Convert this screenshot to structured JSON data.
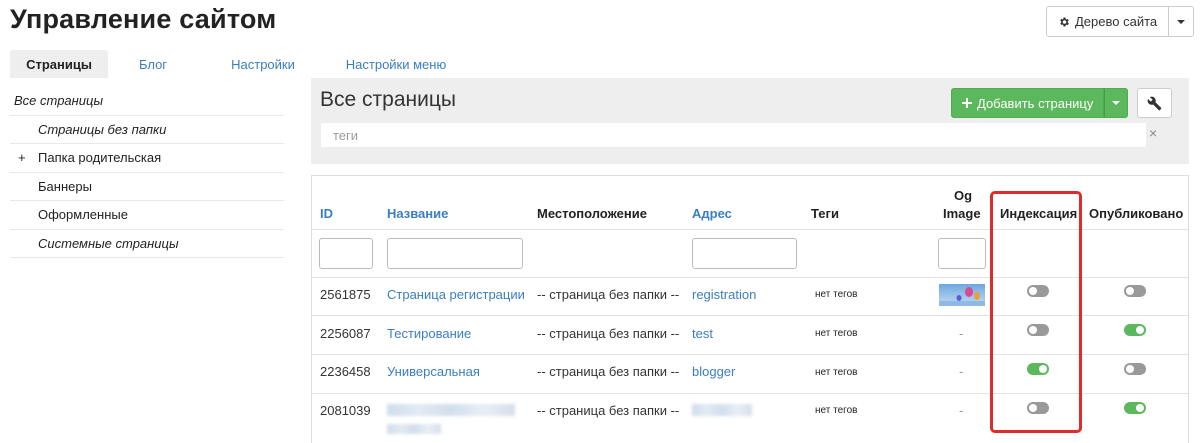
{
  "header": {
    "title": "Управление сайтом",
    "tree_button_label": "Дерево сайта",
    "tree_button_icon": "gear-icon",
    "tree_caret_icon": "caret-down-icon"
  },
  "tabs": [
    {
      "label": "Страницы",
      "active": true
    },
    {
      "label": "Блог",
      "active": false
    },
    {
      "label": "Настройки",
      "active": false
    },
    {
      "label": "Настройки меню",
      "active": false
    }
  ],
  "sidebar": {
    "items": [
      {
        "label": "Все страницы",
        "italic": true
      },
      {
        "label": "Страницы без папки",
        "italic": true
      },
      {
        "label": "Папка родительская",
        "expand": "+"
      },
      {
        "label": "Баннеры"
      },
      {
        "label": "Оформленные"
      },
      {
        "label": "Системные страницы",
        "italic": true
      }
    ]
  },
  "panel": {
    "title": "Все страницы",
    "add_button_label": "Добавить страницу",
    "add_button_icon": "plus-icon",
    "wrench_icon": "wrench-icon",
    "tags_placeholder": "теги",
    "clear_symbol": "×"
  },
  "table": {
    "columns": {
      "id": "ID",
      "name": "Название",
      "location": "Местоположение",
      "address": "Адрес",
      "tags": "Теги",
      "og_line1": "Og",
      "og_line2": "Image",
      "indexing": "Индексация",
      "published": "Опубликовано"
    },
    "rows": [
      {
        "id": "2561875",
        "name": "Страница регистрации",
        "location": "-- страница без папки --",
        "address": "registration",
        "tags": "нет тегов",
        "og": "image",
        "indexing": false,
        "published": false
      },
      {
        "id": "2256087",
        "name": "Тестирование",
        "location": "-- страница без папки --",
        "address": "test",
        "tags": "нет тегов",
        "og": "-",
        "indexing": false,
        "published": true
      },
      {
        "id": "2236458",
        "name": "Универсальная",
        "location": "-- страница без папки --",
        "address": "blogger",
        "tags": "нет тегов",
        "og": "-",
        "indexing": true,
        "published": false
      },
      {
        "id": "2081039",
        "name": "",
        "location": "-- страница без папки --",
        "address": "",
        "tags": "нет тегов",
        "og": "-",
        "indexing": false,
        "published": true
      }
    ]
  },
  "colors": {
    "accent_link": "#3a7fc1",
    "toggle_on": "#5cb85c",
    "toggle_off": "#999999",
    "highlight": "#e02b2b"
  }
}
